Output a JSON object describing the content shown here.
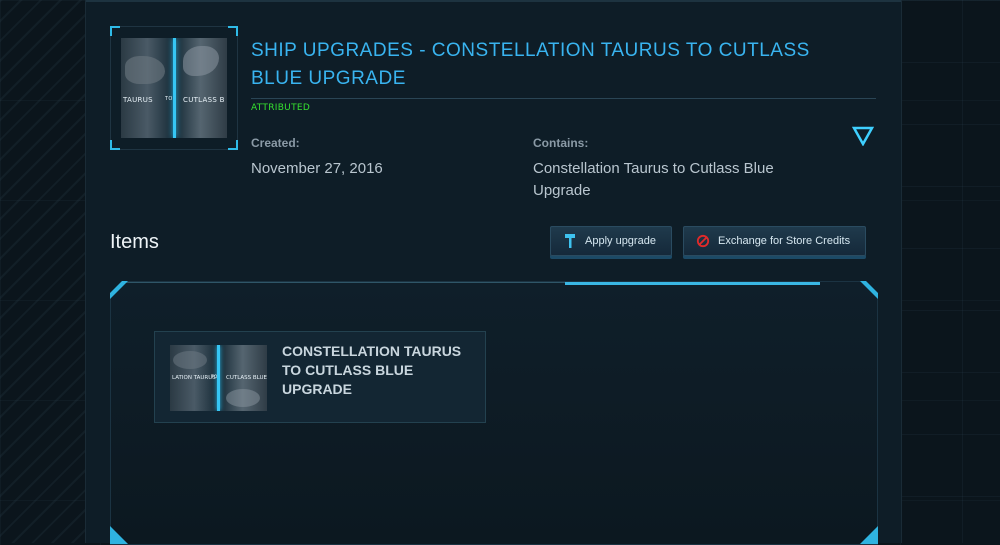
{
  "pledge": {
    "title": "SHIP UPGRADES - CONSTELLATION TAURUS TO CUTLASS BLUE UPGRADE",
    "status": "ATTRIBUTED",
    "status_color": "#35e02f",
    "thumbnail": {
      "left_label": "TAURUS",
      "middle_label": "TO",
      "right_label": "CUTLASS B"
    },
    "created_label": "Created:",
    "created_value": "November 27, 2016",
    "contains_label": "Contains:",
    "contains_value": "Constellation Taurus to Cutlass Blue Upgrade",
    "toggle_icon": "triangle-down-icon"
  },
  "items_section": {
    "heading": "Items",
    "buttons": {
      "apply_label": "Apply upgrade",
      "apply_icon": "hammer-icon",
      "exchange_label": "Exchange for Store Credits",
      "exchange_icon": "prohibited-icon"
    },
    "items": [
      {
        "title": "CONSTELLATION TAURUS TO CUTLASS BLUE UPGRADE",
        "thumbnail": {
          "left_label": "LATION TAURUS",
          "middle_label": "TO",
          "right_label": "CUTLASS BLUE"
        }
      }
    ]
  },
  "colors": {
    "accent": "#39b4f0",
    "background": "#0e1d27"
  }
}
